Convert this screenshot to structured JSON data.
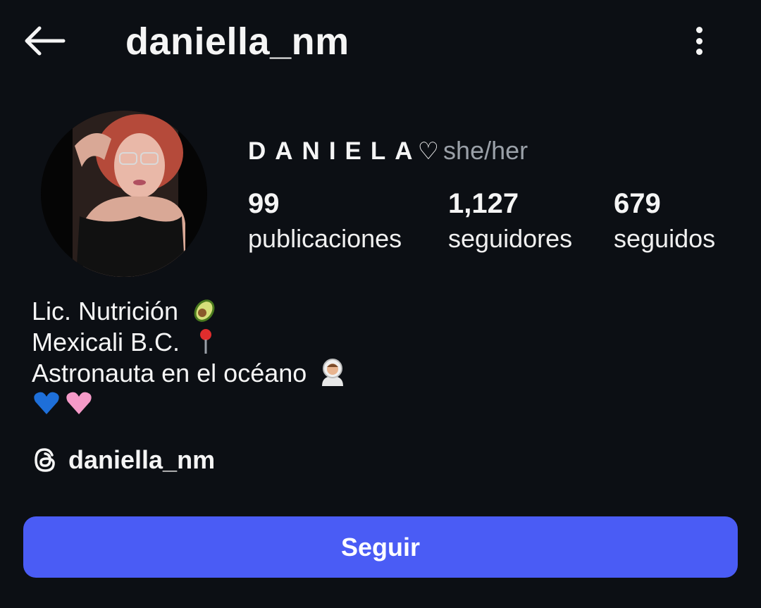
{
  "header": {
    "back_icon": "arrow-left-icon",
    "username": "daniella_nm",
    "more_icon": "more-vertical-icon"
  },
  "profile": {
    "display_name": "DANIELA",
    "name_suffix": "♡",
    "pronouns": "she/her",
    "stats": {
      "posts": {
        "count": "99",
        "label": "publicaciones"
      },
      "followers": {
        "count": "1,127",
        "label": "seguidores"
      },
      "following": {
        "count": "679",
        "label": "seguidos"
      }
    },
    "bio": {
      "line1": "Lic. Nutrición",
      "line1_icon": "avocado-icon",
      "line2": "Mexicali B.C.",
      "line2_icon": "pin-icon",
      "line3": "Astronauta en el océano",
      "line3_icon": "astronaut-icon",
      "line4_icons": [
        "blue-heart-icon",
        "pink-heart-icon"
      ]
    },
    "threads": {
      "icon": "threads-icon",
      "username": "daniella_nm"
    }
  },
  "actions": {
    "follow_label": "Seguir"
  },
  "colors": {
    "background": "#0c0f14",
    "text": "#f5f5f5",
    "muted": "#9aa0a8",
    "follow_button": "#4a5cf5"
  }
}
